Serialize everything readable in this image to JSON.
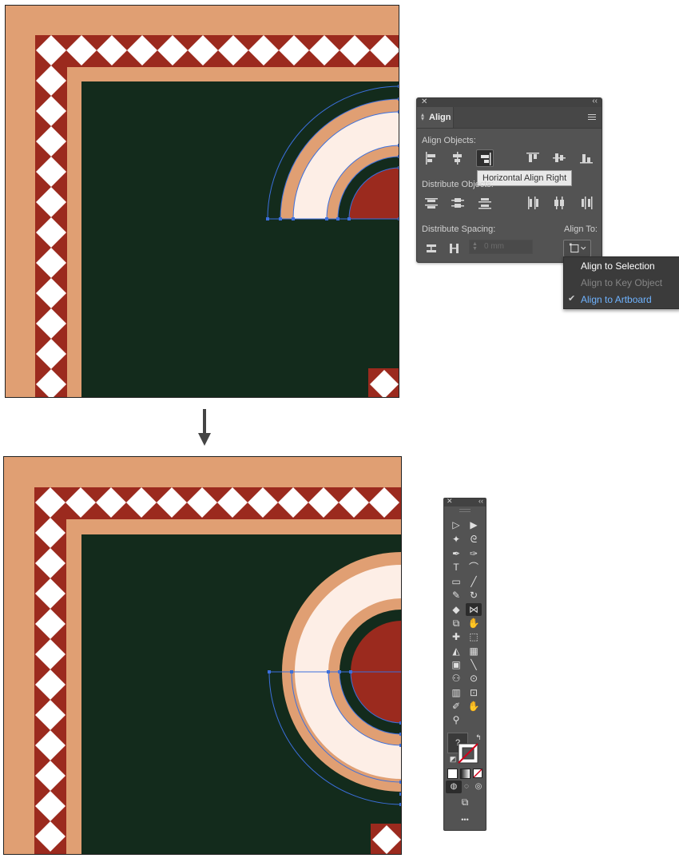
{
  "colors": {
    "peach": "#e09f73",
    "red": "#9b2a1e",
    "white": "#ffffff",
    "dark_green": "#132b1c",
    "cream": "#fdeee6",
    "selection_blue": "#3b6fdc"
  },
  "align_panel": {
    "close_icon": "close-icon",
    "collapse_icon": "double-chevron-icon",
    "tab_label": "Align",
    "menu_icon": "hamburger-menu-icon",
    "align_objects_label": "Align Objects:",
    "tooltip": "Horizontal Align Right",
    "distribute_objects_label": "Distribute Objects:",
    "distribute_spacing_label": "Distribute Spacing:",
    "align_to_label": "Align To:",
    "spacing_value": "0 mm",
    "align_icons": [
      "horizontal-align-left-icon",
      "horizontal-align-center-icon",
      "horizontal-align-right-icon",
      "vertical-align-top-icon",
      "vertical-align-center-icon",
      "vertical-align-bottom-icon"
    ],
    "distribute_icons": [
      "vertical-distribute-top-icon",
      "vertical-distribute-center-icon",
      "vertical-distribute-bottom-icon",
      "horizontal-distribute-left-icon",
      "horizontal-distribute-center-icon",
      "horizontal-distribute-right-icon"
    ]
  },
  "align_to_menu": {
    "items": [
      {
        "label": "Align to Selection",
        "state": "highlighted"
      },
      {
        "label": "Align to Key Object",
        "state": "disabled"
      },
      {
        "label": "Align to Artboard",
        "state": "checked"
      }
    ]
  },
  "flow_arrow": "down-arrow-icon",
  "tools_panel": {
    "rows": [
      [
        "selection-tool-icon",
        "direct-selection-tool-icon"
      ],
      [
        "magic-wand-tool-icon",
        "lasso-tool-icon"
      ],
      [
        "pen-tool-icon",
        "curvature-tool-icon"
      ],
      [
        "type-tool-icon",
        "arc-tool-icon"
      ],
      [
        "rectangle-tool-icon",
        "line-segment-tool-icon"
      ],
      [
        "paintbrush-tool-icon",
        "shaper-tool-icon"
      ],
      [
        "eraser-tool-icon",
        "reflect-tool-icon"
      ],
      [
        "scale-tool-icon",
        "warp-tool-icon"
      ],
      [
        "puppet-warp-tool-icon",
        "free-transform-tool-icon"
      ],
      [
        "shape-builder-tool-icon",
        "perspective-grid-tool-icon"
      ],
      [
        "mesh-tool-icon",
        "gradient-tool-icon"
      ],
      [
        "eyedropper-tool-icon",
        "blend-tool-icon"
      ],
      [
        "symbol-sprayer-tool-icon",
        "column-graph-tool-icon"
      ],
      [
        "artboard-tool-icon",
        "slice-tool-icon"
      ],
      [
        "hand-tool-icon",
        "zoom-tool-icon"
      ]
    ],
    "fill_label": "?",
    "more_label": "•••"
  }
}
